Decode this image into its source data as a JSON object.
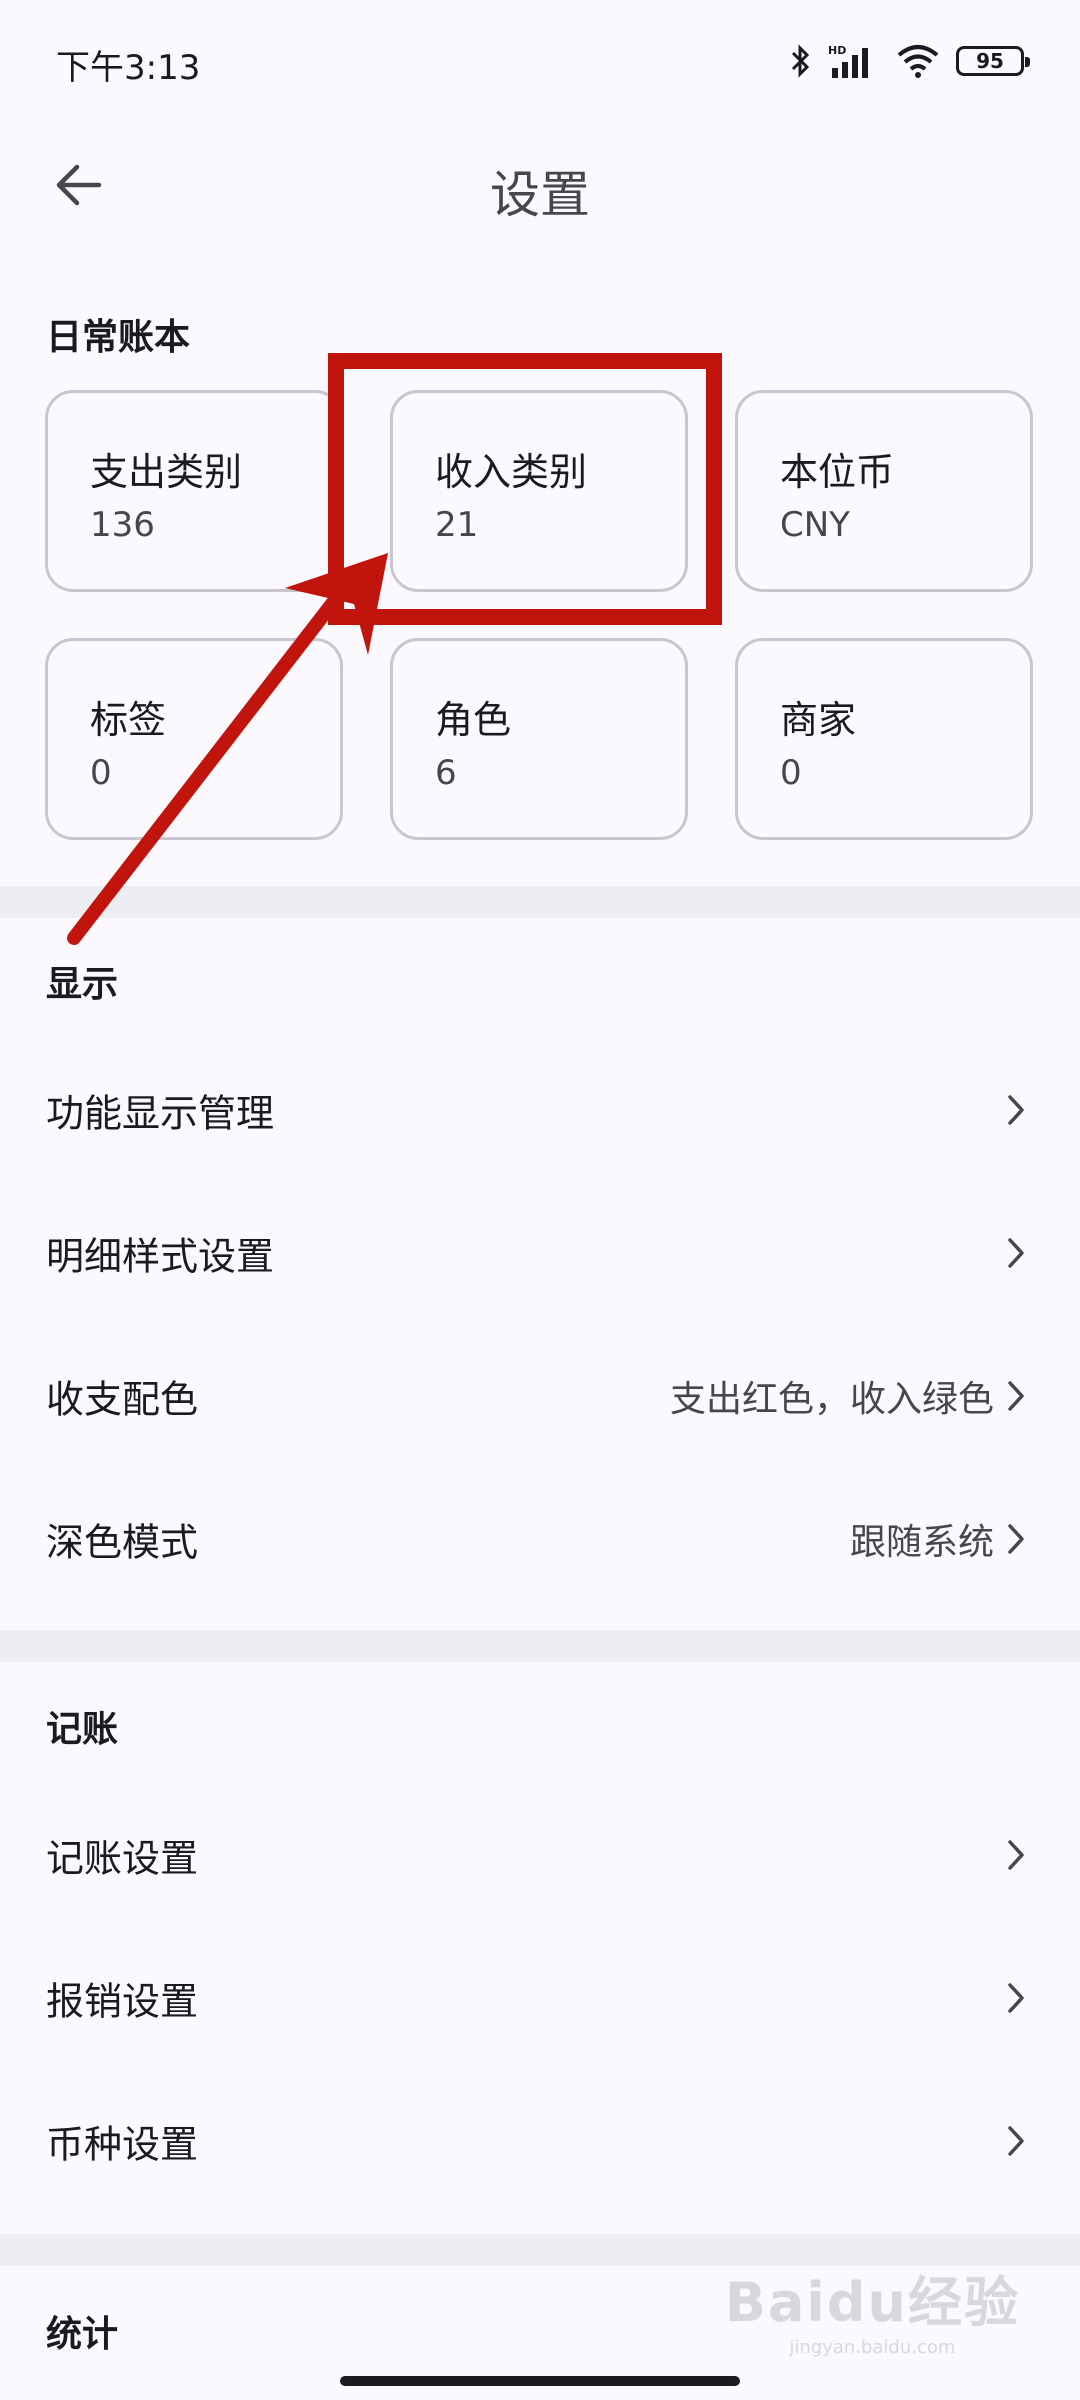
{
  "status_bar": {
    "time": "下午3:13",
    "battery": "95",
    "icons": [
      "bluetooth-icon",
      "hd-signal-icon",
      "wifi-icon",
      "battery-icon"
    ]
  },
  "app_bar": {
    "title": "设置",
    "back_icon": "arrow-left-icon"
  },
  "daily_ledger": {
    "header": "日常账本",
    "cards": [
      {
        "title": "支出类别",
        "value": "136"
      },
      {
        "title": "收入类别",
        "value": "21"
      },
      {
        "title": "本位币",
        "value": "CNY"
      },
      {
        "title": "标签",
        "value": "0"
      },
      {
        "title": "角色",
        "value": "6"
      },
      {
        "title": "商家",
        "value": "0"
      }
    ]
  },
  "display": {
    "header": "显示",
    "items": [
      {
        "label": "功能显示管理",
        "value": ""
      },
      {
        "label": "明细样式设置",
        "value": ""
      },
      {
        "label": "收支配色",
        "value": "支出红色，收入绿色"
      },
      {
        "label": "深色模式",
        "value": "跟随系统"
      }
    ]
  },
  "bookkeeping": {
    "header": "记账",
    "items": [
      {
        "label": "记账设置"
      },
      {
        "label": "报销设置"
      },
      {
        "label": "币种设置"
      }
    ]
  },
  "statistics": {
    "header": "统计"
  },
  "watermark": {
    "logo": "Baidu经验",
    "url": "jingyan.baidu.com"
  },
  "colors": {
    "background": "#fbf8fe",
    "card_border": "#c9c6d0",
    "divider": "#eeedf3",
    "annotation_red": "#c0140c"
  }
}
